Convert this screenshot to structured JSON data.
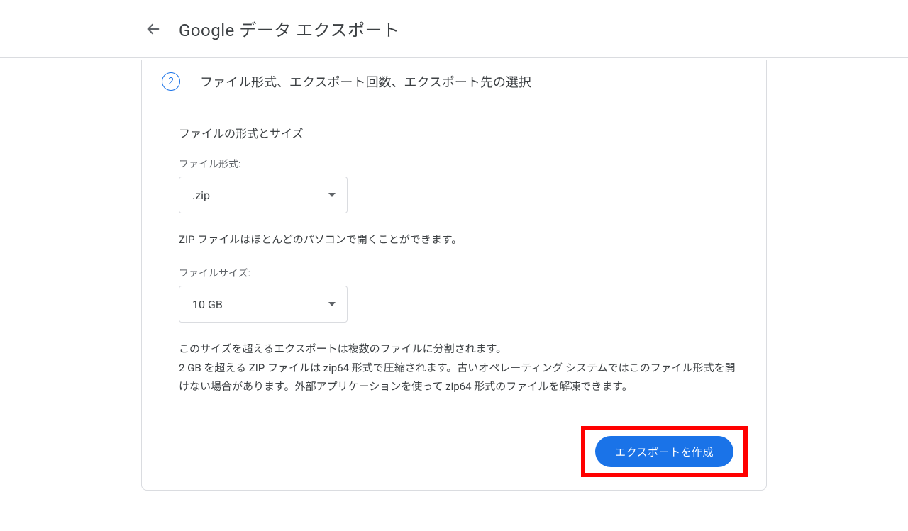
{
  "header": {
    "title": "Google データ エクスポート"
  },
  "step": {
    "number": "2",
    "title": "ファイル形式、エクスポート回数、エクスポート先の選択"
  },
  "section": {
    "heading": "ファイルの形式とサイズ",
    "file_type_label": "ファイル形式:",
    "file_type_value": ".zip",
    "file_type_help": "ZIP ファイルはほとんどのパソコンで開くことができます。",
    "file_size_label": "ファイルサイズ:",
    "file_size_value": "10 GB",
    "file_size_help": "このサイズを超えるエクスポートは複数のファイルに分割されます。\n2 GB を超える ZIP ファイルは zip64 形式で圧縮されます。古いオペレーティング システムではこのファイル形式を開けない場合があります。外部アプリケーションを使って zip64 形式のファイルを解凍できます。"
  },
  "footer": {
    "create_button": "エクスポートを作成"
  }
}
